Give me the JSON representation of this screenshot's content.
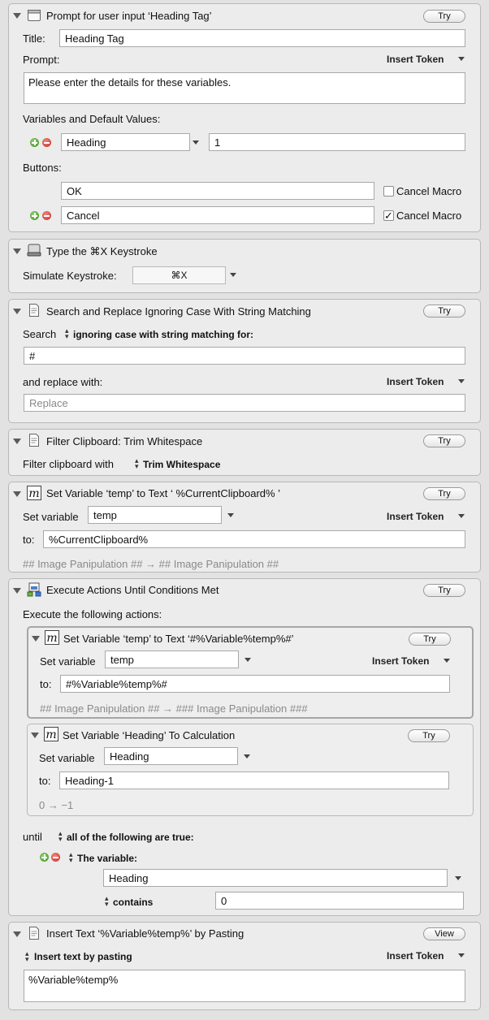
{
  "a1": {
    "title": "Prompt for user input ‘Heading Tag’",
    "try": "Try",
    "title_label": "Title:",
    "title_value": "Heading Tag",
    "prompt_label": "Prompt:",
    "insert_token": "Insert Token",
    "prompt_value": "Please enter the details for these variables.",
    "variables_label": "Variables and Default Values:",
    "var_name": "Heading",
    "var_default": "1",
    "buttons_label": "Buttons:",
    "button1": "OK",
    "button2": "Cancel",
    "cancel_macro": "Cancel Macro",
    "check_mark": "✓"
  },
  "a2": {
    "title": "Type the ⌘X Keystroke",
    "simulate_label": "Simulate Keystroke:",
    "keystroke": "⌘X"
  },
  "a3": {
    "title": "Search and Replace Ignoring Case With String Matching",
    "try": "Try",
    "search_label": "Search",
    "search_mode": "ignoring case with string matching for:",
    "search_value": "#",
    "replace_label": "and replace with:",
    "insert_token": "Insert Token",
    "replace_placeholder": "Replace"
  },
  "a4": {
    "title": "Filter Clipboard: Trim Whitespace",
    "try": "Try",
    "filter_label": "Filter clipboard with",
    "filter_value": "Trim Whitespace"
  },
  "a5": {
    "title": "Set Variable ‘temp’ to Text ‘ %CurrentClipboard% ’",
    "try": "Try",
    "set_label": "Set variable",
    "var_name": "temp",
    "insert_token": "Insert Token",
    "to_label": "to:",
    "to_value": "%CurrentClipboard%",
    "preview": "##  Image Panipulation  ## →  ##  Image Panipulation  ##"
  },
  "a6": {
    "title": "Execute Actions Until Conditions Met",
    "try": "Try",
    "execute_label": "Execute the following actions:",
    "sub1": {
      "title": "Set Variable ‘temp’ to Text ‘#%Variable%temp%#’",
      "try": "Try",
      "set_label": "Set variable",
      "var_name": "temp",
      "insert_token": "Insert Token",
      "to_label": "to:",
      "to_value": "#%Variable%temp%#",
      "preview": "##  Image Panipulation  ## → ###  Image Panipulation  ###"
    },
    "sub2": {
      "title": "Set Variable ‘Heading’ To Calculation",
      "try": "Try",
      "set_label": "Set variable",
      "var_name": "Heading",
      "to_label": "to:",
      "to_value": "Heading-1",
      "preview": "0 → −1"
    },
    "until_label": "until",
    "until_mode": "all of the following are true:",
    "condition_type": "The variable:",
    "condition_var": "Heading",
    "condition_op": "contains",
    "condition_value": "0"
  },
  "a7": {
    "title": "Insert Text ‘%Variable%temp%’ by Pasting",
    "view": "View",
    "mode": "Insert text by pasting",
    "insert_token": "Insert Token",
    "text": "%Variable%temp%"
  },
  "icons": {
    "disclosure": "disclosure-triangle-icon",
    "window": "window-icon",
    "keyboard": "keyboard-icon",
    "document": "document-icon",
    "variable": "variable-m-icon",
    "execute": "execute-icon",
    "plus": "plus-icon",
    "minus": "minus-icon",
    "popup": "popup-arrow-icon",
    "stepper": "stepper-icon"
  }
}
